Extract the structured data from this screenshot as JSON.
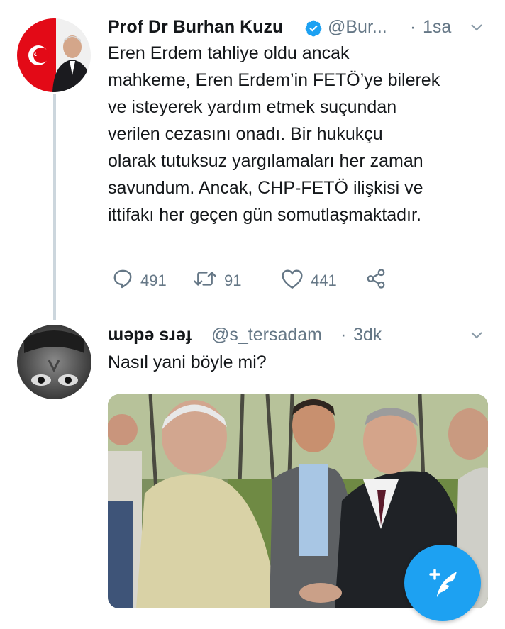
{
  "tweet1": {
    "display_name": "Prof Dr Burhan Kuzu",
    "handle": "@Bur...",
    "separator": "·",
    "time": "1sa",
    "lines": [
      "Eren Erdem tahliye oldu ancak",
      "mahkeme, Eren Erdem’in FETÖ’ye bilerek",
      "ve isteyerek yardım etmek suçundan",
      "verilen cezasını onadı. Bir hukukçu",
      "olarak tutuksuz yargılamaları her zaman",
      "savundum. Ancak, CHP-FETÖ ilişkisi ve",
      "ittifakı her geçen gün somutlaşmaktadır."
    ],
    "replies": "491",
    "retweets": "91",
    "likes": "441"
  },
  "tweet2": {
    "display_name": "ɯǝpǝ sɹǝɟ",
    "handle": "@s_tersadam",
    "separator": "·",
    "time": "3dk",
    "text": "Nasıl yani böyle mi?"
  },
  "colors": {
    "accent": "#1da1f2",
    "verified": "#1da1f2",
    "secondary_text": "#657786",
    "thread_line": "#ccd6dd"
  },
  "icons": [
    "verified-badge-icon",
    "chevron-down-icon",
    "reply-icon",
    "retweet-icon",
    "like-icon",
    "share-icon",
    "compose-tweet-icon"
  ]
}
